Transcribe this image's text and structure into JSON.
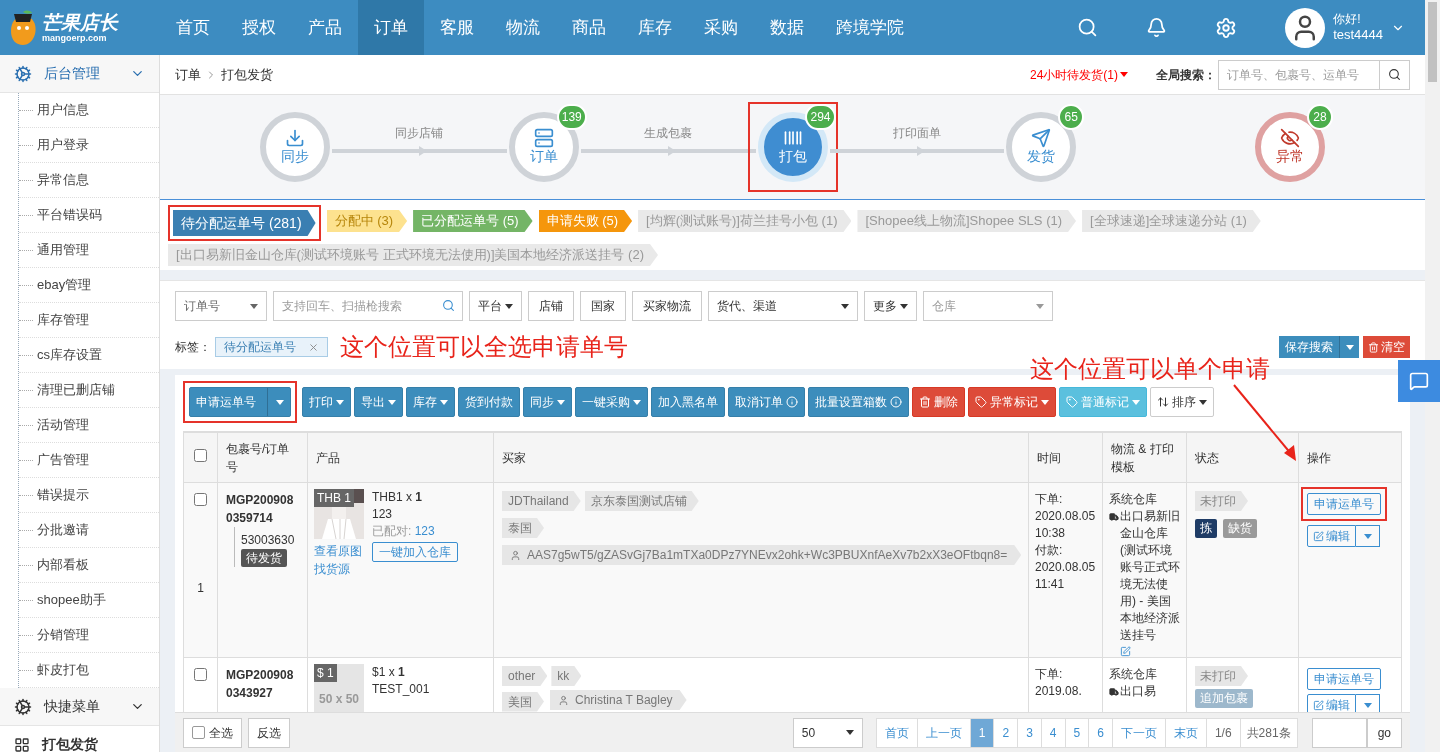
{
  "nav": {
    "logo": {
      "name": "芒果店长",
      "domain": "mangoerp.com"
    },
    "menu": [
      {
        "label": "首页",
        "selected": false
      },
      {
        "label": "授权",
        "selected": false
      },
      {
        "label": "产品",
        "selected": false
      },
      {
        "label": "订单",
        "selected": true
      },
      {
        "label": "客服",
        "selected": false
      },
      {
        "label": "物流",
        "selected": false
      },
      {
        "label": "商品",
        "selected": false
      },
      {
        "label": "库存",
        "selected": false
      },
      {
        "label": "采购",
        "selected": false
      },
      {
        "label": "数据",
        "selected": false
      },
      {
        "label": "跨境学院",
        "selected": false
      }
    ],
    "user": {
      "greeting": "你好!",
      "name": "test4444"
    }
  },
  "sidebar": {
    "sections": [
      {
        "title": "后台管理",
        "expanded": true,
        "selected": false,
        "items": [
          "用户信息",
          "用户登录",
          "异常信息",
          "平台错误码",
          "通用管理",
          "ebay管理",
          "库存管理",
          "cs库存设置",
          "清理已删店铺",
          "活动管理",
          "广告管理",
          "错误提示",
          "分批邀请",
          "内部看板",
          "shopee助手",
          "分销管理",
          "虾皮打包"
        ]
      },
      {
        "title": "快捷菜单",
        "expanded": false,
        "selected": false
      },
      {
        "title": "打包发货",
        "expanded": false,
        "selected": true
      }
    ]
  },
  "breadcrumb": [
    "订单",
    "打包发货"
  ],
  "alert": "24小时待发货(1)",
  "global_search": {
    "label": "全局搜索：",
    "placeholder": "订单号、包裹号、运单号"
  },
  "steps": [
    {
      "kind": "sync",
      "label": "同步",
      "selected": false,
      "highlighted": false
    },
    {
      "kind": "orders",
      "label": "订单",
      "badge": "139",
      "selected": false,
      "highlighted": false
    },
    {
      "kind": "pack",
      "label": "打包",
      "badge": "294",
      "selected": true,
      "highlighted": true
    },
    {
      "kind": "ship",
      "label": "发货",
      "badge": "65",
      "selected": false,
      "highlighted": false
    },
    {
      "kind": "error",
      "label": "异常",
      "badge": "28",
      "selected": false,
      "highlighted": false
    }
  ],
  "connectors": [
    "同步店铺",
    "生成包裹",
    "打印面单"
  ],
  "status_tags": [
    {
      "label": "待分配运单号 (281)",
      "color": "#3a7fb2",
      "selected": true,
      "highlighted": true
    },
    {
      "label": "分配中 (3)",
      "color": "#fde28f",
      "selected": false,
      "highlighted": false
    },
    {
      "label": "已分配运单号 (5)",
      "color": "#74b566",
      "selected": false,
      "highlighted": false
    },
    {
      "label": "申请失败 (5)",
      "color": "#f5960c",
      "selected": false,
      "highlighted": false
    },
    {
      "label": "[均辉(测试账号)]荷兰挂号小包 (1)",
      "color": "#e9e9e9",
      "selected": false,
      "highlighted": false
    },
    {
      "label": "[Shopee线上物流]Shopee SLS (1)",
      "color": "#e9e9e9",
      "selected": false,
      "highlighted": false
    },
    {
      "label": "[全球速递]全球速递分站 (1)",
      "color": "#e9e9e9",
      "selected": false,
      "highlighted": false
    },
    {
      "label": "[出口易新旧金山仓库(测试环境账号 正式环境无法使用)]美国本地经济派送挂号 (2)",
      "color": "#e9e9e9",
      "selected": false,
      "highlighted": false
    }
  ],
  "filters": [
    {
      "kind": "select",
      "label": "订单号"
    },
    {
      "kind": "search",
      "placeholder": "支持回车、扫描枪搜索"
    },
    {
      "kind": "dropdown",
      "label": "平台"
    },
    {
      "kind": "button",
      "label": "店铺"
    },
    {
      "kind": "button",
      "label": "国家"
    },
    {
      "kind": "button",
      "label": "买家物流"
    },
    {
      "kind": "select",
      "label": "货代、渠道"
    },
    {
      "kind": "dropdown",
      "label": "更多"
    },
    {
      "kind": "select",
      "placeholder": "仓库"
    }
  ],
  "tag_filter": {
    "label": "标签：",
    "tags": [
      "待分配运单号"
    ]
  },
  "save_search": "保存搜索",
  "clear": "清空",
  "annotations": [
    "这个位置可以全选申请单号",
    "这个位置可以单个申请"
  ],
  "toolbar": [
    {
      "label": "申请运单号",
      "kind": "primary",
      "split": true,
      "highlighted": true
    },
    {
      "label": "打印",
      "kind": "primary",
      "dropdown": true
    },
    {
      "label": "导出",
      "kind": "primary",
      "dropdown": true
    },
    {
      "label": "库存",
      "kind": "primary",
      "dropdown": true
    },
    {
      "label": "货到付款",
      "kind": "primary"
    },
    {
      "label": "同步",
      "kind": "primary",
      "dropdown": true
    },
    {
      "label": "一键采购",
      "kind": "primary",
      "dropdown": true
    },
    {
      "label": "加入黑名单",
      "kind": "primary"
    },
    {
      "label": "取消订单",
      "kind": "notice"
    },
    {
      "label": "批量设置箱数",
      "kind": "notice"
    },
    {
      "label": "删除",
      "kind": "danger"
    },
    {
      "label": "异常标记",
      "kind": "warning",
      "dropdown": true
    },
    {
      "label": "普通标记",
      "kind": "info",
      "dropdown": true
    },
    {
      "label": "排序",
      "kind": "default",
      "dropdown": true
    }
  ],
  "table": {
    "select_all_checked": false,
    "columns": [
      "包裹号/订单号",
      "产品",
      "买家",
      "时间",
      "物流 & 打印模板",
      "状态",
      "操作"
    ],
    "rows": [
      {
        "index": "1",
        "checked": false,
        "package_no": "MGP2009080359714",
        "order_no": "53003630",
        "order_status": "待发货",
        "product": {
          "thumb_label": "THB 1",
          "title": "THB1 x **1**",
          "sku": "123",
          "matched_label": "已配对:",
          "matched": "123",
          "links": [
            "查看原图",
            "找货源"
          ],
          "action": "一键加入仓库"
        },
        "buyer": {
          "tags": [
            "JDThailand",
            "京东泰国测试店铺"
          ],
          "country": "泰国",
          "buyer_id": "AAS7g5wT5/gZASvGj7Ba1mTXa0DPz7YNEvx2ohk+Wc3PBUXnfAeXv7b2xX3eOFtbqn8="
        },
        "time": [
          "下单:",
          "2020.08.05 10:38",
          "付款:",
          "2020.08.05 11:41"
        ],
        "logistics": {
          "warehouse": "系统仓库",
          "route": "出口易新旧金山仓库(测试环境账号正式环境无法使用) - 美国本地经济派送挂号",
          "editable": true
        },
        "status": {
          "print": "未打印",
          "badges": [
            {
              "label": "拣",
              "color": "#1f3c66"
            },
            {
              "label": "缺货",
              "color": "#9a9a9a"
            }
          ]
        },
        "actions": {
          "apply": "申请运单号",
          "edit": "编辑",
          "highlighted": true
        }
      },
      {
        "checked": false,
        "package_no": "MGP2009080343927",
        "product": {
          "thumb_label": "$ 1",
          "thumb_text": "50 x 50",
          "title": "$1 x **1**",
          "sku": "TEST_001"
        },
        "buyer": {
          "tags": [
            "other",
            "kk"
          ],
          "country": "美国",
          "buyer_id": "Christina T Bagley"
        },
        "time": [
          "下单:",
          "2019.08."
        ],
        "logistics": {
          "warehouse": "系统仓库",
          "route": "出口易",
          "editable": false
        },
        "status": {
          "print": "未打印",
          "badges": [
            {
              "label": "追加包裹",
              "color": "#9db8cc"
            }
          ]
        },
        "actions": {
          "apply": "申请运单号",
          "edit": "编辑",
          "highlighted": false
        }
      }
    ]
  },
  "pagination": {
    "select_all": {
      "label": "全选",
      "checked": false
    },
    "invert": "反选",
    "page_size": "50",
    "pages": [
      {
        "label": "首页",
        "selected": false
      },
      {
        "label": "上一页",
        "selected": false
      },
      {
        "label": "1",
        "selected": true
      },
      {
        "label": "2",
        "selected": false
      },
      {
        "label": "3",
        "selected": false
      },
      {
        "label": "4",
        "selected": false
      },
      {
        "label": "5",
        "selected": false
      },
      {
        "label": "6",
        "selected": false
      },
      {
        "label": "下一页",
        "selected": false
      },
      {
        "label": "末页",
        "selected": false
      }
    ],
    "page_info": "1/6",
    "total": "共281条",
    "go": "go"
  }
}
